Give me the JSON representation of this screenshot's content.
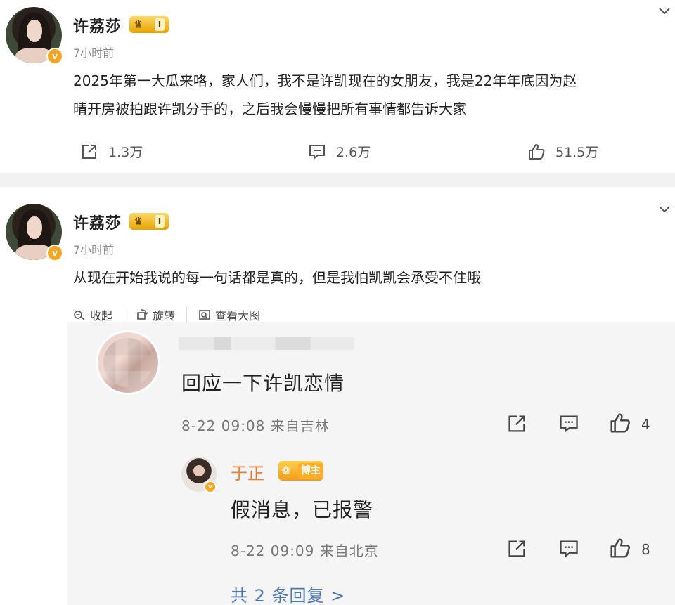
{
  "post1": {
    "author": "许荔莎",
    "level": "I",
    "time": "7小时前",
    "text_line1": "2025年第一大瓜来咯，家人们，我不是许凯现在的女朋友，我是22年年底因为赵",
    "text_line2": "晴开房被拍跟许凯分手的，之后我会慢慢把所有事情都告诉大家",
    "reposts": "1.3万",
    "comments": "2.6万",
    "likes": "51.5万"
  },
  "post2": {
    "author": "许荔莎",
    "level": "I",
    "time": "7小时前",
    "text": "从现在开始我说的每一句话都是真的，但是我怕凯凯会承受不住哦",
    "actions": {
      "collect": "收起",
      "rotate": "旋转",
      "view_large": "查看大图"
    },
    "comment": {
      "text": "回应一下许凯恋情",
      "meta": "8-22 09:08 来自吉林",
      "likes": "4"
    },
    "reply": {
      "author": "于正",
      "badge": "博主",
      "text": "假消息，已报警",
      "meta": "8-22 09:09 来自北京",
      "likes": "8"
    },
    "more_replies": "共 2 条回复 >"
  },
  "colors": {
    "accent_orange": "#f07b32",
    "link_blue": "#4a78b8",
    "vip_gold": "#f6a623"
  }
}
